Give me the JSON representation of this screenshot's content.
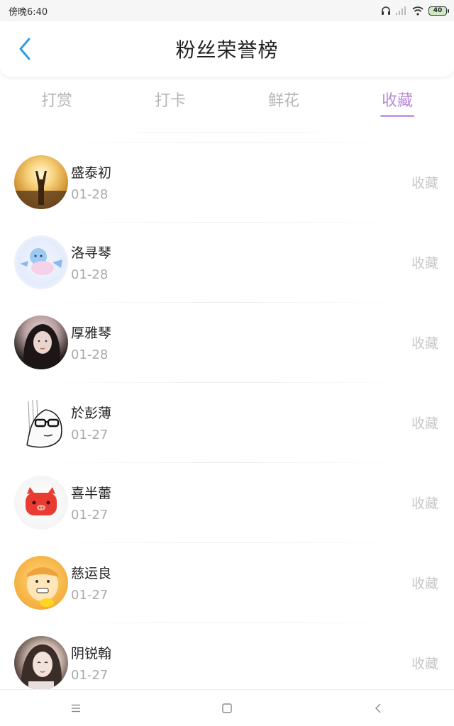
{
  "status_bar": {
    "time": "傍晚6:40",
    "battery": "40"
  },
  "header": {
    "title": "粉丝荣誉榜"
  },
  "tabs": [
    {
      "label": "打赏",
      "active": false
    },
    {
      "label": "打卡",
      "active": false
    },
    {
      "label": "鲜花",
      "active": false
    },
    {
      "label": "收藏",
      "active": true
    }
  ],
  "accent_color": "#c79be6",
  "back_color": "#2e9ee6",
  "list": [
    {
      "name": "盛泰初",
      "date": "01-28",
      "action": "收藏",
      "avatar": "sunset-photo-avatar"
    },
    {
      "name": "洛寻琴",
      "date": "01-28",
      "action": "收藏",
      "avatar": "cartoon-avatar"
    },
    {
      "name": "厚雅琴",
      "date": "01-28",
      "action": "收藏",
      "avatar": "girl-photo-avatar"
    },
    {
      "name": "於彭薄",
      "date": "01-27",
      "action": "收藏",
      "avatar": "glasses-sketch-avatar"
    },
    {
      "name": "喜半蕾",
      "date": "01-27",
      "action": "收藏",
      "avatar": "pig-avatar"
    },
    {
      "name": "慈运良",
      "date": "01-27",
      "action": "收藏",
      "avatar": "yellow-cartoon-avatar"
    },
    {
      "name": "阴锐翰",
      "date": "01-27",
      "action": "收藏",
      "avatar": "woman-photo-avatar"
    }
  ]
}
